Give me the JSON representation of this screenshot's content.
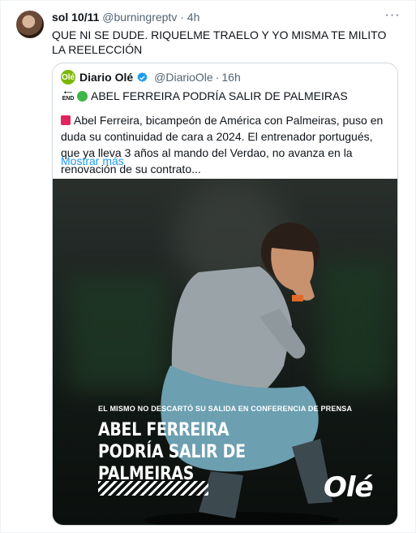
{
  "tweet": {
    "display_name": "sol 10/11",
    "handle": "@burningreptv",
    "separator": "·",
    "time": "4h",
    "more_label": "···",
    "text": "QUE NI SE DUDE. RIQUELME TRAELO Y YO MISMA TE MILITO LA REELECCIÓN"
  },
  "quote": {
    "logo_text": "Olé",
    "display_name": "Diario Olé",
    "handle": "@DiarioOle",
    "separator": "·",
    "time": "16h",
    "end_icon_label": "END",
    "headline": "ABEL FERREIRA PODRÍA SALIR DE PALMEIRAS",
    "body": "Abel Ferreira, bicampeón de América con Palmeiras, puso en duda su continuidad de cara a 2024. El entrenador portugués, que ya lleva 3 años al mando del Verdao, no avanza en la renovación de su contrato...",
    "show_more": "Mostrar más",
    "media": {
      "subtitle": "EL MISMO NO DESCARTÓ SU SALIDA EN CONFERENCIA DE PRENSA",
      "title": "ABEL FERREIRA PODRÍA SALIR DE PALMEIRAS",
      "brand": "Olé"
    }
  },
  "colors": {
    "accent": "#1d9bf0",
    "brand_green": "#7ab800",
    "secondary_text": "#536471"
  }
}
